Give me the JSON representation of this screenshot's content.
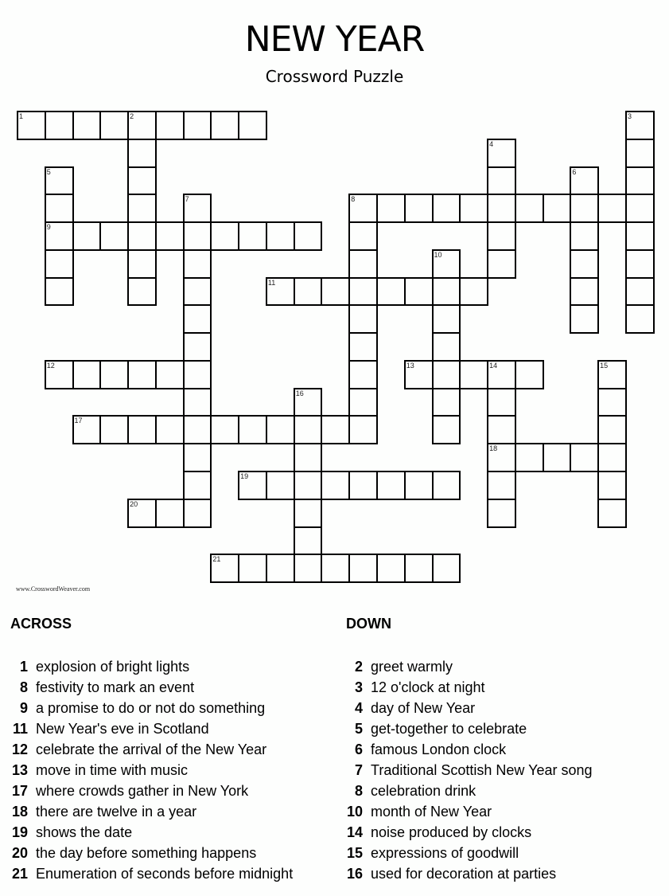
{
  "title": "NEW YEAR",
  "subtitle": "Crossword Puzzle",
  "credit": "www.CrosswordWeaver.com",
  "grid": {
    "words": [
      {
        "num": 1,
        "dir": "across",
        "row": 0,
        "col": 0,
        "length": 9
      },
      {
        "num": 2,
        "dir": "down",
        "row": 0,
        "col": 4,
        "length": 7
      },
      {
        "num": 3,
        "dir": "down",
        "row": 0,
        "col": 22,
        "length": 8
      },
      {
        "num": 4,
        "dir": "down",
        "row": 1,
        "col": 17,
        "length": 5
      },
      {
        "num": 5,
        "dir": "down",
        "row": 2,
        "col": 1,
        "length": 5
      },
      {
        "num": 6,
        "dir": "down",
        "row": 2,
        "col": 20,
        "length": 6
      },
      {
        "num": 7,
        "dir": "down",
        "row": 3,
        "col": 6,
        "length": 12
      },
      {
        "num": 8,
        "dir": "across",
        "row": 3,
        "col": 12,
        "length": 11
      },
      {
        "num": 8,
        "dir": "down",
        "row": 3,
        "col": 12,
        "length": 9
      },
      {
        "num": 9,
        "dir": "across",
        "row": 4,
        "col": 1,
        "length": 10
      },
      {
        "num": 10,
        "dir": "down",
        "row": 5,
        "col": 15,
        "length": 7
      },
      {
        "num": 11,
        "dir": "across",
        "row": 6,
        "col": 9,
        "length": 8
      },
      {
        "num": 12,
        "dir": "across",
        "row": 9,
        "col": 1,
        "length": 6
      },
      {
        "num": 13,
        "dir": "across",
        "row": 9,
        "col": 14,
        "length": 5
      },
      {
        "num": 14,
        "dir": "down",
        "row": 9,
        "col": 17,
        "length": 6
      },
      {
        "num": 15,
        "dir": "down",
        "row": 9,
        "col": 21,
        "length": 6
      },
      {
        "num": 16,
        "dir": "down",
        "row": 10,
        "col": 10,
        "length": 7
      },
      {
        "num": 17,
        "dir": "across",
        "row": 11,
        "col": 2,
        "length": 11
      },
      {
        "num": 18,
        "dir": "across",
        "row": 12,
        "col": 17,
        "length": 5
      },
      {
        "num": 19,
        "dir": "across",
        "row": 13,
        "col": 8,
        "length": 8
      },
      {
        "num": 20,
        "dir": "across",
        "row": 14,
        "col": 4,
        "length": 3
      },
      {
        "num": 21,
        "dir": "across",
        "row": 16,
        "col": 7,
        "length": 9
      }
    ]
  },
  "across": {
    "heading": "ACROSS",
    "clues": [
      {
        "num": "1",
        "text": "explosion of bright lights"
      },
      {
        "num": "8",
        "text": "festivity to mark an event"
      },
      {
        "num": "9",
        "text": "a promise to do or not do something"
      },
      {
        "num": "11",
        "text": "New Year's eve in Scotland"
      },
      {
        "num": "12",
        "text": "celebrate the arrival of the New Year"
      },
      {
        "num": "13",
        "text": "move in time with music"
      },
      {
        "num": "17",
        "text": "where crowds gather in New York"
      },
      {
        "num": "18",
        "text": "there are twelve in a year"
      },
      {
        "num": "19",
        "text": "shows the date"
      },
      {
        "num": "20",
        "text": "the day before something happens"
      },
      {
        "num": "21",
        "text": "Enumeration of seconds before midnight"
      }
    ]
  },
  "down": {
    "heading": "DOWN",
    "clues": [
      {
        "num": "2",
        "text": "greet warmly"
      },
      {
        "num": "3",
        "text": "12 o'clock at night"
      },
      {
        "num": "4",
        "text": "day of New Year"
      },
      {
        "num": "5",
        "text": "get-together to celebrate"
      },
      {
        "num": "6",
        "text": "famous London clock"
      },
      {
        "num": "7",
        "text": "Traditional Scottish New Year song"
      },
      {
        "num": "8",
        "text": "celebration drink"
      },
      {
        "num": "10",
        "text": "month of New Year"
      },
      {
        "num": "14",
        "text": "noise produced by clocks"
      },
      {
        "num": "15",
        "text": "expressions of goodwill"
      },
      {
        "num": "16",
        "text": "used for decoration at parties"
      }
    ]
  }
}
